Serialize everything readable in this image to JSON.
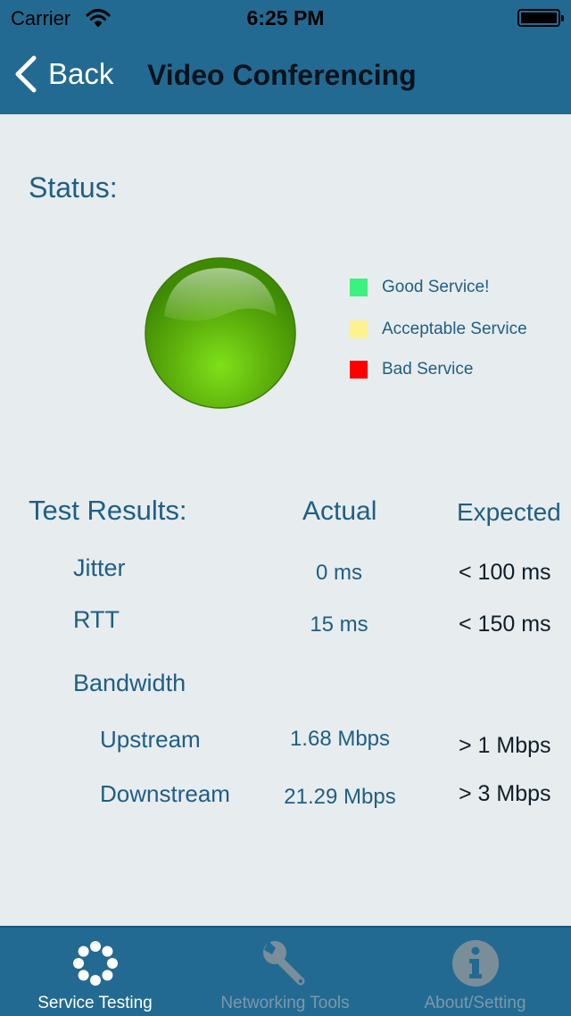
{
  "status_bar": {
    "carrier": "Carrier",
    "time": "6:25 PM"
  },
  "nav": {
    "back_label": "Back",
    "title": "Video Conferencing"
  },
  "status": {
    "label": "Status:",
    "indicator_color": "#5ab20c",
    "legend": [
      {
        "label": "Good Service!",
        "color": "#3cf27e"
      },
      {
        "label": "Acceptable Service",
        "color": "#fdf28e"
      },
      {
        "label": "Bad Service",
        "color": "#ff0000"
      }
    ]
  },
  "results": {
    "title": "Test Results:",
    "col_actual": "Actual",
    "col_expected": "Expected",
    "jitter": {
      "label": "Jitter",
      "actual": "0 ms",
      "expected": "< 100 ms"
    },
    "rtt": {
      "label": "RTT",
      "actual": "15 ms",
      "expected": "< 150 ms"
    },
    "bandwidth": {
      "label": "Bandwidth"
    },
    "upstream": {
      "label": "Upstream",
      "actual": "1.68 Mbps",
      "expected": "> 1 Mbps"
    },
    "downstream": {
      "label": "Downstream",
      "actual": "21.29 Mbps",
      "expected": "> 3 Mbps"
    }
  },
  "tabs": [
    {
      "label": "Service Testing",
      "icon": "spinner-icon",
      "active": true
    },
    {
      "label": "Networking Tools",
      "icon": "wrench-icon",
      "active": false
    },
    {
      "label": "About/Setting",
      "icon": "info-icon",
      "active": false
    }
  ],
  "colors": {
    "bar": "#236a92",
    "background": "#e7ecef",
    "text": "#1f5e84"
  }
}
